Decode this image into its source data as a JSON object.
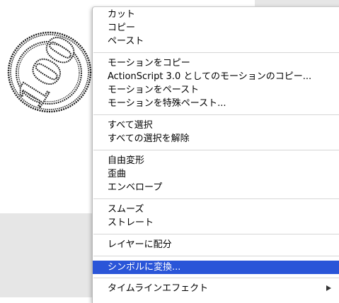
{
  "graphic": {
    "text": "100",
    "icon": "coin-sketch-icon"
  },
  "menu": {
    "groups": [
      [
        "カット",
        "コピー",
        "ペースト"
      ],
      [
        "モーションをコピー",
        "ActionScript 3.0 としてのモーションのコピー...",
        "モーションをペースト",
        "モーションを特殊ペースト..."
      ],
      [
        "すべて選択",
        "すべての選択を解除"
      ],
      [
        "自由変形",
        "歪曲",
        "エンベロープ"
      ],
      [
        "スムーズ",
        "ストレート"
      ],
      [
        "レイヤーに配分"
      ],
      [
        "シンボルに変換..."
      ],
      [
        "タイムラインエフェクト"
      ]
    ],
    "selected_label": "シンボルに変換...",
    "submenu_item_label": "タイムラインエフェクト",
    "colors": {
      "highlight": "#2a55d8",
      "highlight_text": "#ffffff",
      "separator": "#d6d6d6",
      "stage_gray": "#e6e6e6"
    }
  }
}
